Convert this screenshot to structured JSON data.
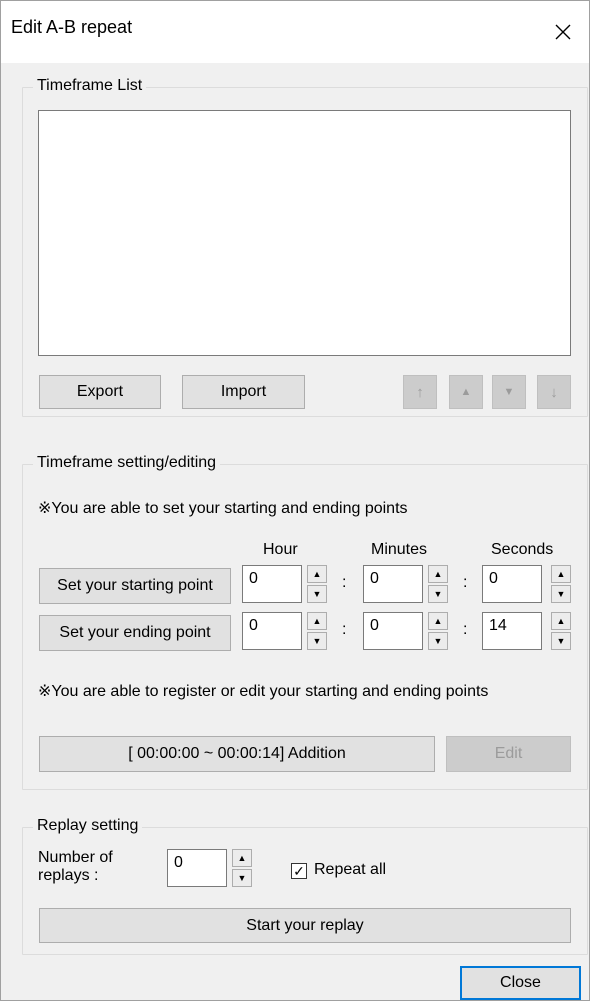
{
  "window": {
    "title": "Edit A-B repeat",
    "close_glyph": "✕"
  },
  "timeframe_list": {
    "title": "Timeframe List",
    "export_label": "Export",
    "import_label": "Import",
    "buttons": {
      "move_top": "↑",
      "move_up": "▲",
      "move_down": "▼",
      "move_bottom": "↓"
    }
  },
  "timeframe_setting": {
    "title": "Timeframe setting/editing",
    "note_top": "※You are able to set your starting and ending points",
    "col_hour": "Hour",
    "col_minutes": "Minutes",
    "col_seconds": "Seconds",
    "start_button": "Set your starting point",
    "end_button": "Set your ending point",
    "start": {
      "hour": "0",
      "minutes": "0",
      "seconds": "0"
    },
    "end": {
      "hour": "0",
      "minutes": "0",
      "seconds": "14"
    },
    "colon": ":",
    "note_bottom": "※You are able to register or edit your starting and ending points",
    "add_button": "[ 00:00:00 ~ 00:00:14] Addition",
    "edit_button": "Edit"
  },
  "replay_setting": {
    "title": "Replay setting",
    "replays_label_line1": "Number of",
    "replays_label_line2": "replays :",
    "replays_value": "0",
    "repeat_all_label": "Repeat all",
    "repeat_all_checked": true,
    "start_button": "Start your replay"
  },
  "footer": {
    "close_button": "Close"
  },
  "icons": {
    "spin_up": "▲",
    "spin_down": "▼",
    "check": "✓"
  }
}
